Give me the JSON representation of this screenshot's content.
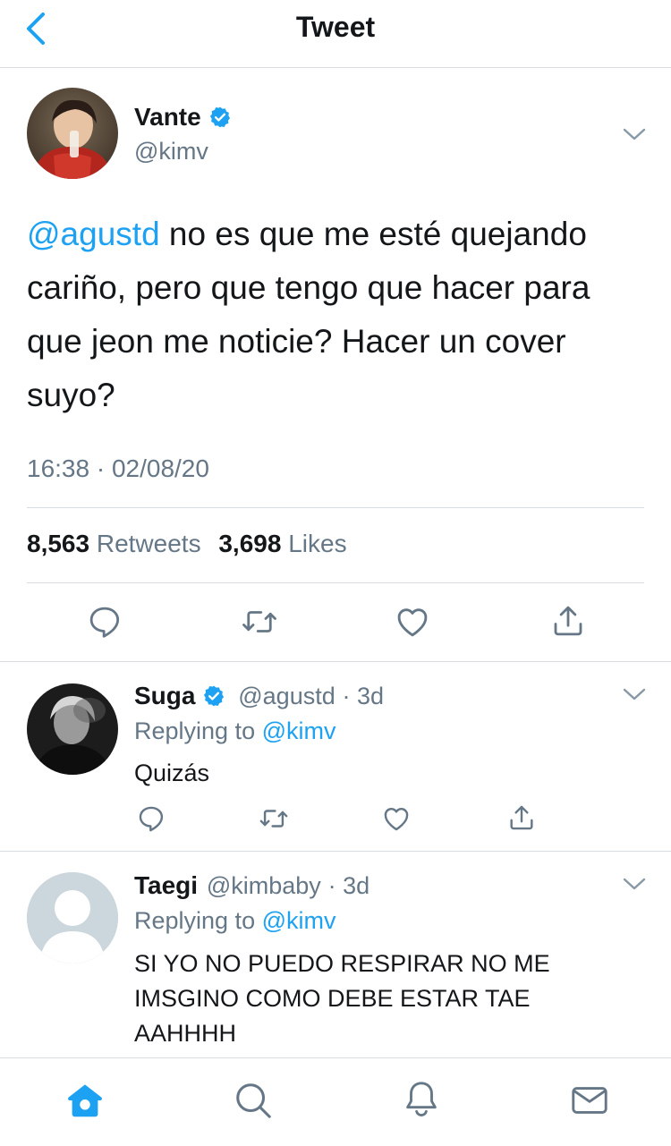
{
  "header": {
    "title": "Tweet"
  },
  "tweet": {
    "name": "Vante",
    "handle": "@kimv",
    "mention": "@agustd",
    "text": " no es que me esté quejando cariño, pero que tengo que hacer para que jeon me noticie? Hacer un cover suyo?",
    "time": "16:38 · 02/08/20",
    "retweets_count": "8,563",
    "retweets_label": "Retweets",
    "likes_count": "3,698",
    "likes_label": "Likes"
  },
  "replies": [
    {
      "name": "Suga",
      "handle": "@agustd",
      "age": "· 3d",
      "replying_label": "Replying to",
      "replying_handle": "@kimv",
      "text": "Quizás"
    },
    {
      "name": "Taegi",
      "handle": "@kimbaby",
      "age": "· 3d",
      "replying_label": "Replying to",
      "replying_handle": "@kimv",
      "text": "SI YO NO PUEDO RESPIRAR NO ME IMSGINO COMO DEBE ESTAR TAE AAHHHH"
    }
  ],
  "icons": {
    "back": "chevron-left-icon",
    "more": "chevron-down-icon",
    "verified": "verified-badge-icon",
    "reply": "reply-icon",
    "retweet": "retweet-icon",
    "like": "heart-icon",
    "share": "share-icon",
    "tabs": [
      "home-icon",
      "search-icon",
      "notifications-icon",
      "messages-icon"
    ]
  },
  "colors": {
    "accent": "#1da1f2",
    "secondary_text": "#657786",
    "divider": "#d9dde1"
  }
}
